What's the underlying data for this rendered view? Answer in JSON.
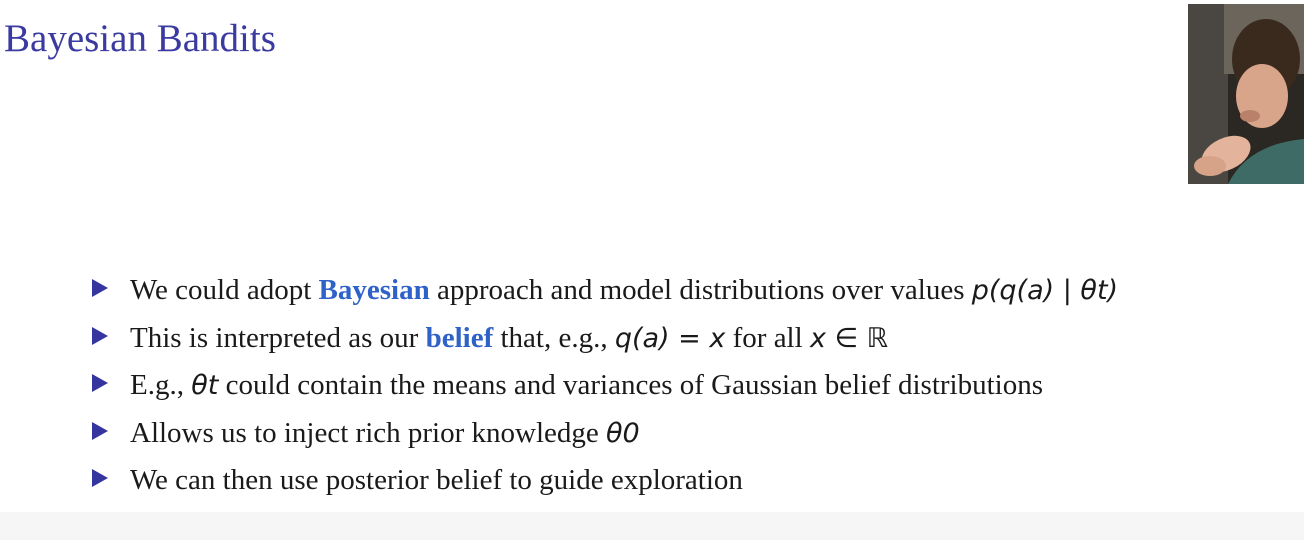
{
  "slide": {
    "title": "Bayesian Bandits",
    "bullets": [
      {
        "pre": "We could adopt ",
        "highlight": "Bayesian",
        "post": " approach and model distributions over values ",
        "math": "p(q(a) | θt)"
      },
      {
        "pre": "This is interpreted as our ",
        "highlight": "belief",
        "post": " that, e.g., ",
        "math": "q(a) = x",
        "post2": " for all ",
        "math2": "x ∈ ℝ"
      },
      {
        "pre": "E.g., ",
        "math": "θt",
        "post": " could contain the means and variances of Gaussian belief distributions"
      },
      {
        "pre": "Allows us to inject rich prior knowledge ",
        "math": "θ0"
      },
      {
        "pre": "We can then use posterior belief to guide exploration"
      }
    ]
  },
  "colors": {
    "title": "#3a3aa0",
    "highlight": "#2f62c8",
    "bullet_marker": "#3535a0",
    "text": "#1a1a1a"
  },
  "icons": {
    "bullet_marker": "triangle-right-icon"
  }
}
